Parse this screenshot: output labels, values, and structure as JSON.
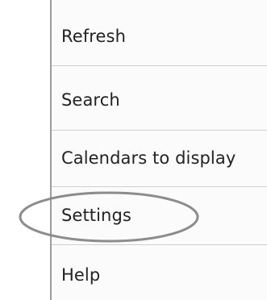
{
  "menu": {
    "items": [
      {
        "id": "refresh",
        "label": "Refresh"
      },
      {
        "id": "search",
        "label": "Search"
      },
      {
        "id": "calendars",
        "label": "Calendars to display"
      },
      {
        "id": "settings",
        "label": "Settings",
        "highlighted": true
      },
      {
        "id": "help",
        "label": "Help"
      }
    ]
  },
  "colors": {
    "menu_background": "#fbfbfb",
    "menu_border": "#9b9b9b",
    "divider": "#cfcfcf",
    "text": "#222222",
    "highlight_ellipse": "#8c8c8c"
  }
}
